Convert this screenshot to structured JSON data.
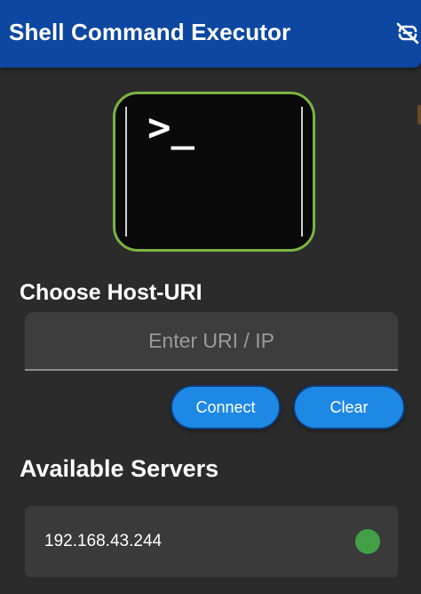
{
  "app_bar": {
    "title": "Shell Command Executor",
    "action_icon": "link-off-icon",
    "background": "#0d47a1"
  },
  "logo": {
    "prompt_text": ">_",
    "border_color": "#7cb342",
    "icon": "terminal-icon"
  },
  "host_section": {
    "title": "Choose Host-URI",
    "input": {
      "value": "",
      "placeholder": "Enter URI / IP"
    },
    "connect_label": "Connect",
    "clear_label": "Clear",
    "button_color": "#1e88e5"
  },
  "servers_section": {
    "title": "Available Servers",
    "items": [
      {
        "address": "192.168.43.244",
        "status_color": "#43a047"
      }
    ]
  }
}
